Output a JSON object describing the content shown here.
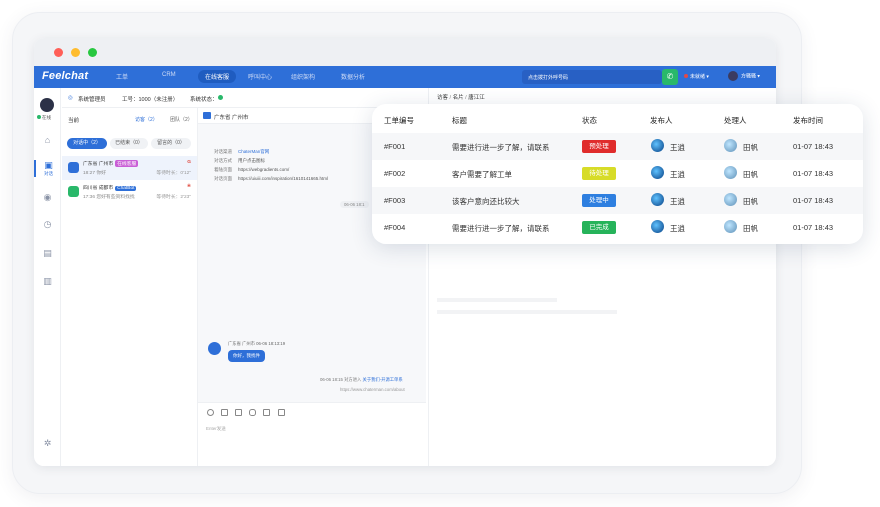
{
  "app": {
    "logo": "Feelchat"
  },
  "nav": {
    "items": [
      "工单",
      "CRM",
      "在线客服",
      "呼叫中心",
      "组织架构",
      "数据分析"
    ],
    "search_placeholder": "点击拨打外呼号码",
    "status": "未就绪",
    "user": "方骚骚"
  },
  "sidebar": {
    "online": "在线",
    "dialog": "对话"
  },
  "toprow": {
    "admin": "系统管理员",
    "workno": "工号：1000（未注册）",
    "status": "系统状态："
  },
  "list": {
    "current": "当前",
    "tab_visitor": "访客（2）",
    "tab_team": "团队（2）",
    "pills": [
      "对话中（2）",
      "已结束（0）",
      "留言的（0）"
    ],
    "conversations": [
      {
        "title": "广东省 广州市",
        "tag": "在线客服",
        "time": "18:27 你好",
        "right": "等待时长：0'12\"",
        "tag_color": "#c95ed6"
      },
      {
        "title": "四川省 成都市",
        "tag": "ChatBot",
        "time": "17:36 您好有些资料找找",
        "right": "等待时长：2'23\"",
        "tag_color": "#2e6fd8"
      }
    ]
  },
  "chat": {
    "title": "广东省 广州市",
    "info": [
      {
        "k": "对话渠道",
        "v": "ChaterMan官网",
        "link": true
      },
      {
        "k": "对话方式",
        "v": "用户点击图标",
        "link": false
      },
      {
        "k": "着陆页面",
        "v": "https://webgradients.com/",
        "link": false
      },
      {
        "k": "对话页面",
        "v": "https://uiuiii.com/inspiration/1610141665.html",
        "link": false
      }
    ],
    "time1": "06-06 18:1",
    "msg_meta": "广东省 广州市 06-06 18:13:19",
    "msg_text": "你好，我找件",
    "sys_prefix": "06-06 18:15 对方进入",
    "sys_link": "关于我们-开源工单系",
    "sys_url": "https://www.chaterman.com/about",
    "placeholder": "Enter发送"
  },
  "right": {
    "crumb_a": "访客",
    "crumb_b": "名片",
    "crumb_c": "唐江江"
  },
  "tickets": {
    "headers": [
      "工单编号",
      "标题",
      "状态",
      "发布人",
      "处理人",
      "发布时间"
    ],
    "rows": [
      {
        "id": "#F001",
        "title": "需要进行进一步了解，请联系",
        "status": "预处理",
        "color": "#e02c2c",
        "publisher": "王逍",
        "handler": "田帆",
        "time": "01-07 18:43"
      },
      {
        "id": "#F002",
        "title": "客户需要了解工单",
        "status": "待处理",
        "color": "#d7dc28",
        "publisher": "王逍",
        "handler": "田帆",
        "time": "01-07 18:43"
      },
      {
        "id": "#F003",
        "title": "该客户意向还比较大",
        "status": "处理中",
        "color": "#2e7fe0",
        "publisher": "王逍",
        "handler": "田帆",
        "time": "01-07 18:43"
      },
      {
        "id": "#F004",
        "title": "需要进行进一步了解，请联系",
        "status": "已完成",
        "color": "#26b35a",
        "publisher": "王逍",
        "handler": "田帆",
        "time": "01-07 18:43"
      }
    ]
  }
}
